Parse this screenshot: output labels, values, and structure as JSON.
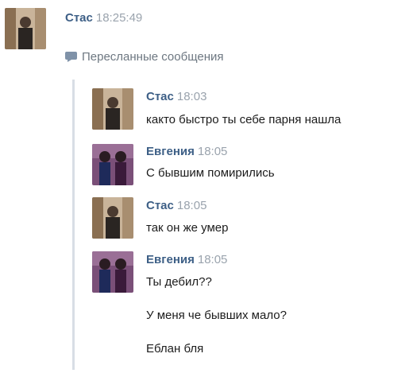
{
  "header": {
    "sender": "Стас",
    "time": "18:25:49"
  },
  "forwarded_label": "Пересланные сообщения",
  "messages": [
    {
      "sender": "Стас",
      "time": "18:03",
      "lines": [
        "както быстро ты себе парня нашла"
      ]
    },
    {
      "sender": "Евгения",
      "time": "18:05",
      "lines": [
        "С бывшим помирились"
      ]
    },
    {
      "sender": "Стас",
      "time": "18:05",
      "lines": [
        "так он же умер"
      ]
    },
    {
      "sender": "Евгения",
      "time": "18:05",
      "lines": [
        "Ты дебил??",
        "У меня че бывших мало?",
        "Еблан бля"
      ]
    }
  ],
  "colors": {
    "name": "#3d5f86",
    "time": "#9aa3ad",
    "quote_line": "#d8dee5"
  }
}
